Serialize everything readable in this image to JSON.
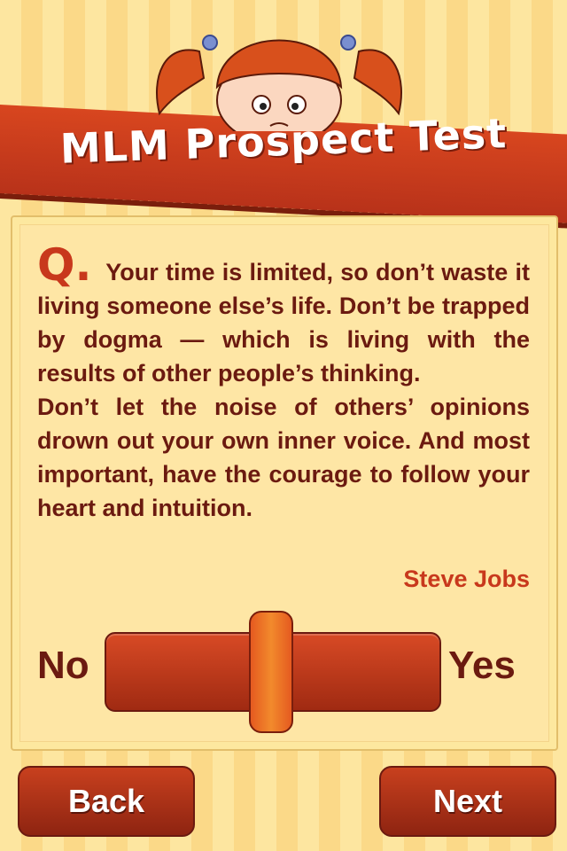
{
  "header": {
    "title": "MLM Prospect Test",
    "mascot_icon": "girl-pigtails-icon"
  },
  "question": {
    "marker": "Q.",
    "text": "Your time is limited, so don’t waste it living someone else’s life. Don’t be trapped by dogma — which is living with the results of other people’s thinking.",
    "text2": "Don’t let the noise of others’ opinions drown out your own inner voice.  And most important, have the courage to follow your heart and intuition.",
    "author": "Steve Jobs"
  },
  "slider": {
    "left_label": "No",
    "right_label": "Yes",
    "value": 0.5
  },
  "buttons": {
    "back": "Back",
    "next": "Next"
  },
  "colors": {
    "accent": "#c8381c",
    "text": "#6b1a10",
    "background": "#fde6a0"
  }
}
